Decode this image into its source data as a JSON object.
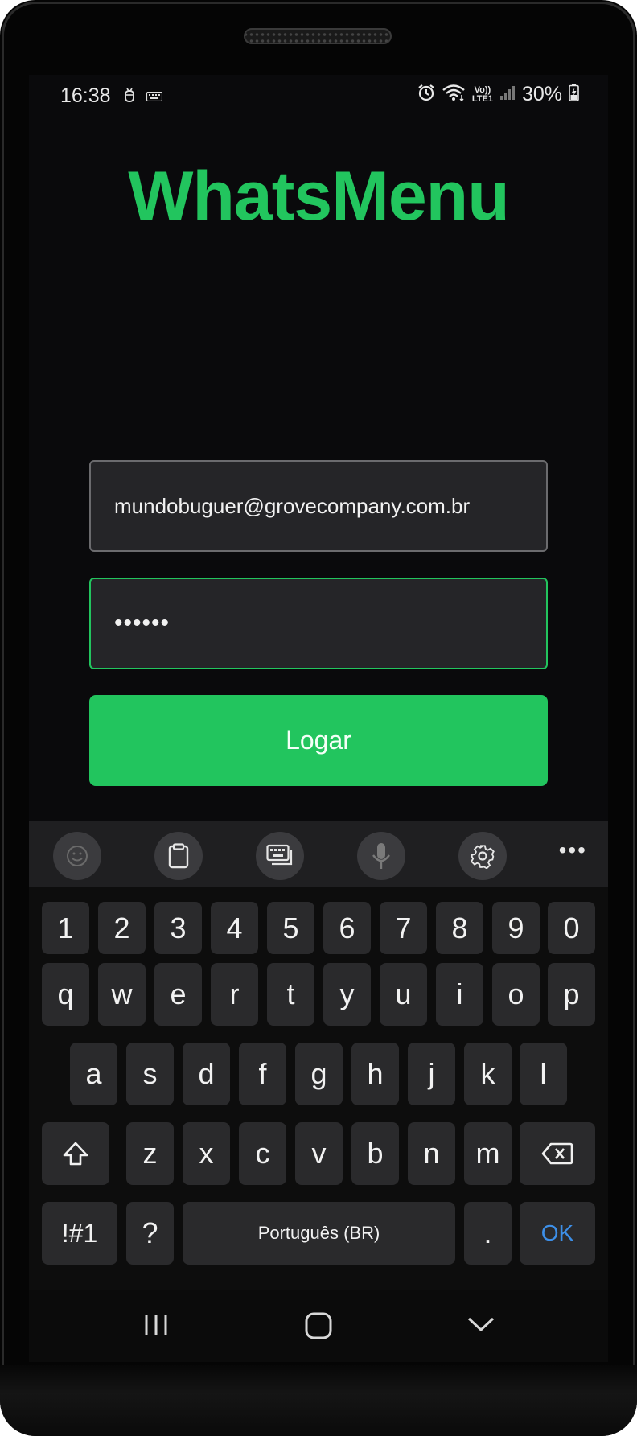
{
  "status_bar": {
    "time": "16:38",
    "left_icons": [
      "bug-icon",
      "keyboard-icon"
    ],
    "right_icons": [
      "alarm-icon",
      "wifi-icon",
      "volte-indicator",
      "signal-icon",
      "battery-charging-icon"
    ],
    "network_line1": "Vo))",
    "network_line2": "LTE1",
    "battery": "30%"
  },
  "app": {
    "title": "WhatsMenu",
    "title_color": "#22c55e"
  },
  "login_form": {
    "email_value": "mundobuguer@grovecompany.com.br",
    "password_value": "••••••",
    "submit_label": "Logar"
  },
  "keyboard": {
    "toolbar": [
      "emoji-icon",
      "clipboard-icon",
      "keyboard-mode-icon",
      "microphone-icon",
      "settings-icon"
    ],
    "more_label": "•••",
    "number_row": [
      "1",
      "2",
      "3",
      "4",
      "5",
      "6",
      "7",
      "8",
      "9",
      "0"
    ],
    "row1": [
      "q",
      "w",
      "e",
      "r",
      "t",
      "y",
      "u",
      "i",
      "o",
      "p"
    ],
    "row2": [
      "a",
      "s",
      "d",
      "f",
      "g",
      "h",
      "j",
      "k",
      "l"
    ],
    "row3": [
      "z",
      "x",
      "c",
      "v",
      "b",
      "n",
      "m"
    ],
    "symbols_label": "!#1",
    "question_label": "?",
    "space_label": "Português (BR)",
    "period_label": ".",
    "ok_label": "OK",
    "ok_color": "#3d8fe8"
  },
  "nav_bar": {
    "buttons": [
      "recent-apps-icon",
      "home-icon",
      "back-icon"
    ]
  }
}
